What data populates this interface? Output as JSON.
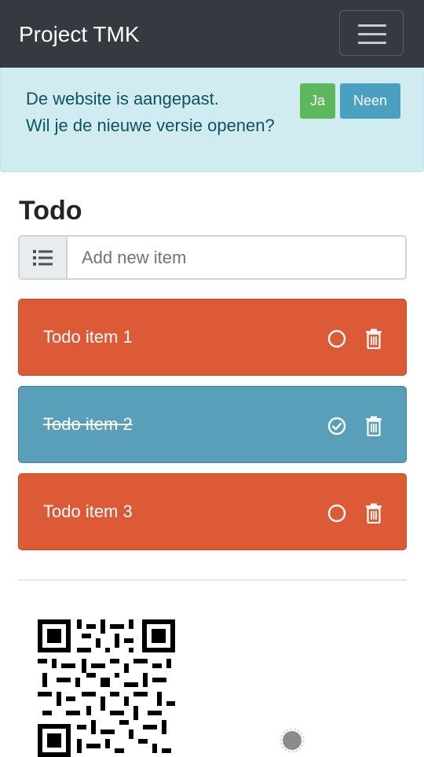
{
  "navbar": {
    "brand": "Project TMK",
    "menu_icon": "hamburger-menu-icon"
  },
  "update_alert": {
    "line1": "De website is aangepast.",
    "line2": "Wil je de nieuwe versie openen?",
    "yes_label": "Ja",
    "no_label": "Neen",
    "yes_color": "#5cb85c",
    "no_color": "#4b9fc0",
    "background": "#d1ecf1"
  },
  "todo": {
    "title": "Todo",
    "input_placeholder": "Add new item",
    "input_value": "",
    "input_icon": "list-icon",
    "items": [
      {
        "label": "Todo item 1",
        "done": false,
        "status_icon": "circle-icon",
        "delete_icon": "trash-icon"
      },
      {
        "label": "Todo item 2",
        "done": true,
        "status_icon": "check-circle-icon",
        "delete_icon": "trash-icon"
      },
      {
        "label": "Todo item 3",
        "done": false,
        "status_icon": "circle-icon",
        "delete_icon": "trash-icon"
      }
    ],
    "colors": {
      "open": "#dc5a35",
      "done": "#5a9fb9"
    }
  },
  "footer": {
    "qr_icon": "qr-code-icon",
    "loading_icon": "loading-spinner-icon"
  }
}
